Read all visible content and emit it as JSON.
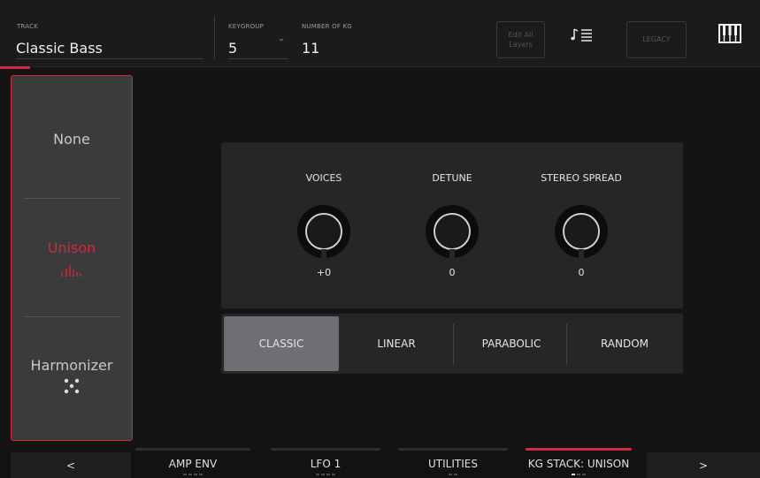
{
  "header": {
    "track_label": "TRACK",
    "track_name": "Classic Bass",
    "keygroup_label": "KEYGROUP",
    "keygroup_value": "5",
    "num_kg_label": "NUMBER OF KG",
    "num_kg_value": "11",
    "edit_all_line1": "Edit All",
    "edit_all_line2": "Layers",
    "legacy_label": "LEGACY",
    "note_list_icon": "note-list-icon",
    "piano_icon": "piano-keyboard-icon"
  },
  "sidebar": {
    "items": [
      {
        "label": "None"
      },
      {
        "label": "Unison",
        "active": true,
        "icon": "unison-bars-icon"
      },
      {
        "label": "Harmonizer",
        "icon": "harmonizer-dots-icon"
      }
    ]
  },
  "knobs": [
    {
      "title": "VOICES",
      "value": "+0"
    },
    {
      "title": "DETUNE",
      "value": "0"
    },
    {
      "title": "STEREO SPREAD",
      "value": "0"
    }
  ],
  "modes": {
    "options": [
      "CLASSIC",
      "LINEAR",
      "PARABOLIC",
      "RANDOM"
    ],
    "selected": "CLASSIC"
  },
  "bottom_nav": {
    "prev": "<",
    "next": ">",
    "tabs": [
      {
        "label": "AMP ENV",
        "active": false
      },
      {
        "label": "LFO 1",
        "active": false
      },
      {
        "label": "UTILITIES",
        "active": false
      },
      {
        "label": "KG STACK: UNISON",
        "active": true
      }
    ]
  },
  "colors": {
    "accent": "#d3283d",
    "background": "#141414",
    "panel": "#262626",
    "selected_mode": "#6e6e73"
  }
}
